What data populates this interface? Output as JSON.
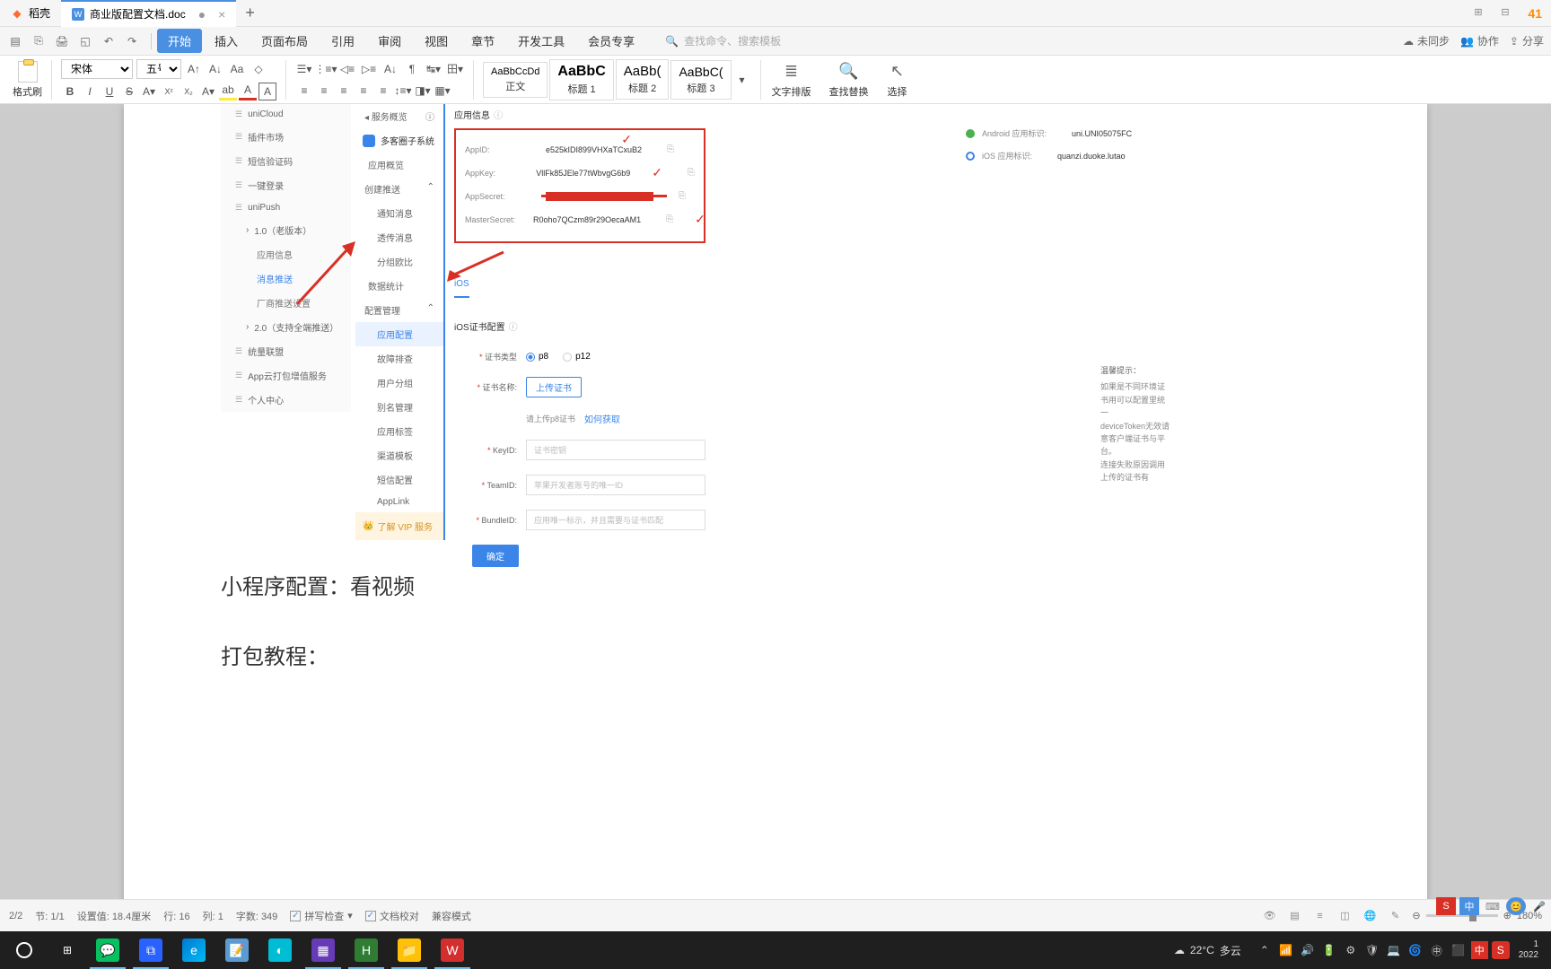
{
  "tabs": [
    {
      "title": "稻壳",
      "icon_color": "#ff6b35"
    },
    {
      "title": "商业版配置文档.doc",
      "icon_color": "#4a90e2",
      "dirty": true
    }
  ],
  "titlebar_right_num": "41",
  "menubar": {
    "tabs": [
      "开始",
      "插入",
      "页面布局",
      "引用",
      "审阅",
      "视图",
      "章节",
      "开发工具",
      "会员专享"
    ],
    "active_index": 0,
    "search_placeholder": "查找命令、搜索模板",
    "unsync": "未同步",
    "collab": "协作",
    "share": "分享"
  },
  "ribbon": {
    "paste_label": "格式刷",
    "font_name": "宋体",
    "font_size": "五号",
    "styles": [
      {
        "sample": "AaBbCcDd",
        "name": "正文",
        "size": "11px"
      },
      {
        "sample": "AaBbC",
        "name": "标题 1",
        "size": "16px",
        "bold": true
      },
      {
        "sample": "AaBb(",
        "name": "标题 2",
        "size": "15px"
      },
      {
        "sample": "AaBbC(",
        "name": "标题 3",
        "size": "14px"
      }
    ],
    "big_buttons": [
      {
        "label": "文字排版",
        "icon": "≡"
      },
      {
        "label": "查找替换",
        "icon": "🔍"
      },
      {
        "label": "选择",
        "icon": "↖"
      }
    ]
  },
  "embed": {
    "sidebar1": {
      "items": [
        "uniCloud",
        "插件市场",
        "短信验证码",
        "一键登录",
        "uniPush"
      ],
      "unipush_children": {
        "v1": "1.0（老版本）",
        "v1_children": [
          "应用信息",
          "消息推送",
          "厂商推送设置"
        ],
        "v1_active_index": 1,
        "v2": "2.0（支持全端推送）"
      },
      "items2": [
        "统量联盟",
        "App云打包增值服务",
        "个人中心"
      ]
    },
    "sidebar2": {
      "header": "多客圈子系统",
      "root": "服务概览",
      "items": [
        "应用概览",
        "创建推送",
        "通知消息",
        "透传消息",
        "分组欧比",
        "数据统计",
        "配置管理",
        "应用配置",
        "故障排查",
        "用户分组",
        "别名管理",
        "应用标签",
        "渠道模板",
        "短信配置",
        "AppLink"
      ],
      "active": "应用配置",
      "vip": "了解 VIP 服务"
    },
    "content": {
      "header": "应用信息",
      "info": {
        "appid_label": "AppID:",
        "appid": "e525kIDI899VHXaTCxuB2",
        "appkey_label": "AppKey:",
        "appkey": "VllFk85JEle77tWbvgG6b9",
        "appsecret_label": "AppSecret:",
        "mastersecret_label": "MasterSecret:",
        "mastersecret": "R0oho7QCzm89r29OecaAM1"
      },
      "right_info": {
        "android_label": "Android 应用标识:",
        "android_val": "uni.UNI05075FC",
        "ios_label": "iOS 应用标识:",
        "ios_val": "quanzi.duoke.lutao"
      },
      "tab": "iOS",
      "form": {
        "title": "iOS证书配置",
        "cert_type_label": "证书类型",
        "cert_type_opts": [
          "p8",
          "p12"
        ],
        "cert_name_label": "证书名称:",
        "upload_btn": "上传证书",
        "upload_hint": "请上传p8证书",
        "upload_link": "如何获取",
        "keyid_label": "KeyID:",
        "keyid_ph": "证书密钥",
        "teamid_label": "TeamID:",
        "teamid_ph": "苹果开发者账号的唯一ID",
        "bundleid_label": "BundleID:",
        "bundleid_ph": "应用唯一标示，并且需要与证书匹配",
        "submit": "确定"
      },
      "tip": {
        "title": "温馨提示：",
        "lines": [
          "如果是不同环境证书用可以配置里统一",
          "deviceToken无效请意客户端证书与平台。",
          "连接失败原因调用上传的证书有"
        ]
      }
    }
  },
  "body_texts": {
    "line1": "小程序配置：看视频",
    "line2": "打包教程："
  },
  "statusbar": {
    "page": "2/2",
    "section": "节: 1/1",
    "setval": "设置值: 18.4厘米",
    "line": "行: 16",
    "col": "列: 1",
    "words": "字数: 349",
    "spellcheck": "拼写检查",
    "doccheck": "文档校对",
    "compat": "兼容模式",
    "zoom": "180%"
  },
  "taskbar": {
    "weather_temp": "22°C",
    "weather_desc": "多云",
    "ime": "中",
    "ime2": "中",
    "sogou": "S",
    "time": "1",
    "date": "2022"
  }
}
